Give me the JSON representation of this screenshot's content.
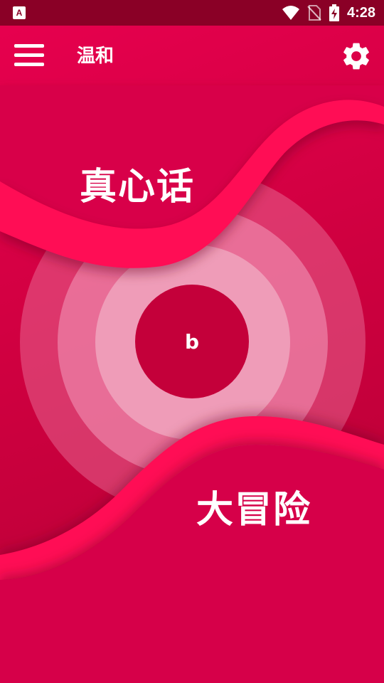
{
  "status_bar": {
    "app_indicator": "A",
    "time": "4:28",
    "icons": [
      "wifi-icon",
      "no-sim-icon",
      "battery-charging-icon"
    ]
  },
  "app_bar": {
    "title": "温和",
    "menu_icon": "menu-icon",
    "settings_icon": "gear-icon"
  },
  "main": {
    "truth_label": "真心话",
    "dare_label": "大冒险",
    "center_label": "b"
  },
  "colors": {
    "background": "#d10042",
    "status_bar": "#8a0026",
    "wave": "#ff0a55",
    "center_button": "#c4003a",
    "inner_ring": "#ef9cb8"
  }
}
